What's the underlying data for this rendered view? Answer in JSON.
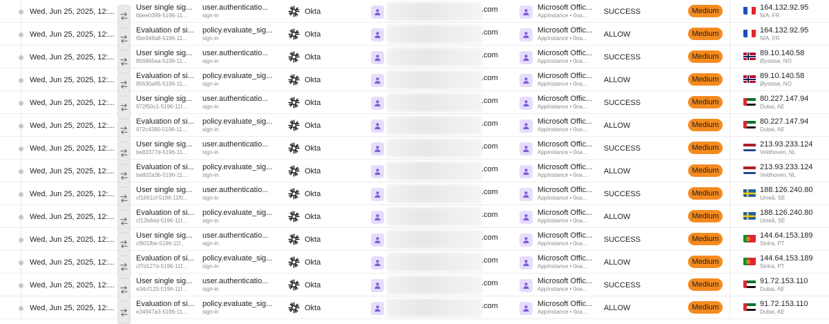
{
  "colors": {
    "severity_medium": "#f58a1f",
    "avatar_bg": "#e6dcfb",
    "avatar_fg": "#7c5cd6"
  },
  "icons": {
    "event": "arrows-transfer-icon",
    "actor_source": "okta-logo-icon",
    "user": "user-avatar-icon",
    "app": "app-avatar-icon"
  },
  "rows": [
    {
      "timestamp": "Wed, Jun 25, 2025, 12:...",
      "event_name": "User single sig...",
      "event_id": "6bee0399-5196-11...",
      "event_type": "user.authenticatio...",
      "event_category": "sign-in",
      "source": "Okta",
      "actor_domain": ".com",
      "target_name": "Microsoft Offic...",
      "target_sub": "AppInstance • 0oa...",
      "outcome": "SUCCESS",
      "severity": "Medium",
      "country": "fr",
      "ip": "164.132.92.95",
      "location": "N/A, FR"
    },
    {
      "timestamp": "Wed, Jun 25, 2025, 12:...",
      "event_name": "Evaluation of si...",
      "event_id": "6be948a8-5196-11...",
      "event_type": "policy.evaluate_sig...",
      "event_category": "sign-in",
      "source": "Okta",
      "actor_domain": ".com",
      "target_name": "Microsoft Offic...",
      "target_sub": "AppInstance • 0oa...",
      "outcome": "ALLOW",
      "severity": "Medium",
      "country": "fr",
      "ip": "164.132.92.95",
      "location": "N/A, FR"
    },
    {
      "timestamp": "Wed, Jun 25, 2025, 12:...",
      "event_name": "User single sig...",
      "event_id": "856665ea-5196-11...",
      "event_type": "user.authenticatio...",
      "event_category": "sign-in",
      "source": "Okta",
      "actor_domain": ".com",
      "target_name": "Microsoft Offic...",
      "target_sub": "AppInstance • 0oa...",
      "outcome": "SUCCESS",
      "severity": "Medium",
      "country": "no",
      "ip": "89.10.140.58",
      "location": "Øystese, NO"
    },
    {
      "timestamp": "Wed, Jun 25, 2025, 12:...",
      "event_name": "Evaluation of si...",
      "event_id": "85630a85-5196-11...",
      "event_type": "policy.evaluate_sig...",
      "event_category": "sign-in",
      "source": "Okta",
      "actor_domain": ".com",
      "target_name": "Microsoft Offic...",
      "target_sub": "AppInstance • 0oa...",
      "outcome": "ALLOW",
      "severity": "Medium",
      "country": "no",
      "ip": "89.10.140.58",
      "location": "Øystese, NO"
    },
    {
      "timestamp": "Wed, Jun 25, 2025, 12:...",
      "event_name": "User single sig...",
      "event_id": "972f50c1-5196-11f...",
      "event_type": "user.authenticatio...",
      "event_category": "sign-in",
      "source": "Okta",
      "actor_domain": ".com",
      "target_name": "Microsoft Offic...",
      "target_sub": "AppInstance • 0oa...",
      "outcome": "SUCCESS",
      "severity": "Medium",
      "country": "ae",
      "ip": "80.227.147.94",
      "location": "Dubai, AE"
    },
    {
      "timestamp": "Wed, Jun 25, 2025, 12:...",
      "event_name": "Evaluation of si...",
      "event_id": "972c4380-5196-11...",
      "event_type": "policy.evaluate_sig...",
      "event_category": "sign-in",
      "source": "Okta",
      "actor_domain": ".com",
      "target_name": "Microsoft Offic...",
      "target_sub": "AppInstance • 0oa...",
      "outcome": "ALLOW",
      "severity": "Medium",
      "country": "ae",
      "ip": "80.227.147.94",
      "location": "Dubai, AE"
    },
    {
      "timestamp": "Wed, Jun 25, 2025, 12:...",
      "event_name": "User single sig...",
      "event_id": "be83377d-5196-11...",
      "event_type": "user.authenticatio...",
      "event_category": "sign-in",
      "source": "Okta",
      "actor_domain": ".com",
      "target_name": "Microsoft Offic...",
      "target_sub": "AppInstance • 0oa...",
      "outcome": "SUCCESS",
      "severity": "Medium",
      "country": "nl",
      "ip": "213.93.233.124",
      "location": "Veldhoven, NL"
    },
    {
      "timestamp": "Wed, Jun 25, 2025, 12:...",
      "event_name": "Evaluation of si...",
      "event_id": "be802a3b-5196-11...",
      "event_type": "policy.evaluate_sig...",
      "event_category": "sign-in",
      "source": "Okta",
      "actor_domain": ".com",
      "target_name": "Microsoft Offic...",
      "target_sub": "AppInstance • 0oa...",
      "outcome": "ALLOW",
      "severity": "Medium",
      "country": "nl",
      "ip": "213.93.233.124",
      "location": "Veldhoven, NL"
    },
    {
      "timestamp": "Wed, Jun 25, 2025, 12:...",
      "event_name": "User single sig...",
      "event_id": "cf1661cf-5196-11f0...",
      "event_type": "user.authenticatio...",
      "event_category": "sign-in",
      "source": "Okta",
      "actor_domain": ".com",
      "target_name": "Microsoft Offic...",
      "target_sub": "AppInstance • 0oa...",
      "outcome": "SUCCESS",
      "severity": "Medium",
      "country": "se",
      "ip": "188.126.240.80",
      "location": "Umeå, SE"
    },
    {
      "timestamp": "Wed, Jun 25, 2025, 12:...",
      "event_name": "Evaluation of si...",
      "event_id": "cf12b84d-5196-11f...",
      "event_type": "policy.evaluate_sig...",
      "event_category": "sign-in",
      "source": "Okta",
      "actor_domain": ".com",
      "target_name": "Microsoft Offic...",
      "target_sub": "AppInstance • 0oa...",
      "outcome": "ALLOW",
      "severity": "Medium",
      "country": "se",
      "ip": "188.126.240.80",
      "location": "Umeå, SE"
    },
    {
      "timestamp": "Wed, Jun 25, 2025, 12:...",
      "event_name": "User single sig...",
      "event_id": "cf801fbe-5196-11f...",
      "event_type": "user.authenticatio...",
      "event_category": "sign-in",
      "source": "Okta",
      "actor_domain": ".com",
      "target_name": "Microsoft Offic...",
      "target_sub": "AppInstance • 0oa...",
      "outcome": "SUCCESS",
      "severity": "Medium",
      "country": "pt",
      "ip": "144.64.153.189",
      "location": "Sintra, PT"
    },
    {
      "timestamp": "Wed, Jun 25, 2025, 12:...",
      "event_name": "Evaluation of si...",
      "event_id": "cf7d127d-5196-11f...",
      "event_type": "policy.evaluate_sig...",
      "event_category": "sign-in",
      "source": "Okta",
      "actor_domain": ".com",
      "target_name": "Microsoft Offic...",
      "target_sub": "AppInstance • 0oa...",
      "outcome": "ALLOW",
      "severity": "Medium",
      "country": "pt",
      "ip": "144.64.153.189",
      "location": "Sintra, PT"
    },
    {
      "timestamp": "Wed, Jun 25, 2025, 12:...",
      "event_name": "User single sig...",
      "event_id": "e34cf125-5196-11f...",
      "event_type": "user.authenticatio...",
      "event_category": "sign-in",
      "source": "Okta",
      "actor_domain": ".com",
      "target_name": "Microsoft Offic...",
      "target_sub": "AppInstance • 0oa...",
      "outcome": "SUCCESS",
      "severity": "Medium",
      "country": "ae",
      "ip": "91.72.153.110",
      "location": "Dubai, AE"
    },
    {
      "timestamp": "Wed, Jun 25, 2025, 12:...",
      "event_name": "Evaluation of si...",
      "event_id": "e34947a3-5196-11...",
      "event_type": "policy.evaluate_sig...",
      "event_category": "sign-in",
      "source": "Okta",
      "actor_domain": ".com",
      "target_name": "Microsoft Offic...",
      "target_sub": "AppInstance • 0oa...",
      "outcome": "ALLOW",
      "severity": "Medium",
      "country": "ae",
      "ip": "91.72.153.110",
      "location": "Dubai, AE"
    }
  ]
}
